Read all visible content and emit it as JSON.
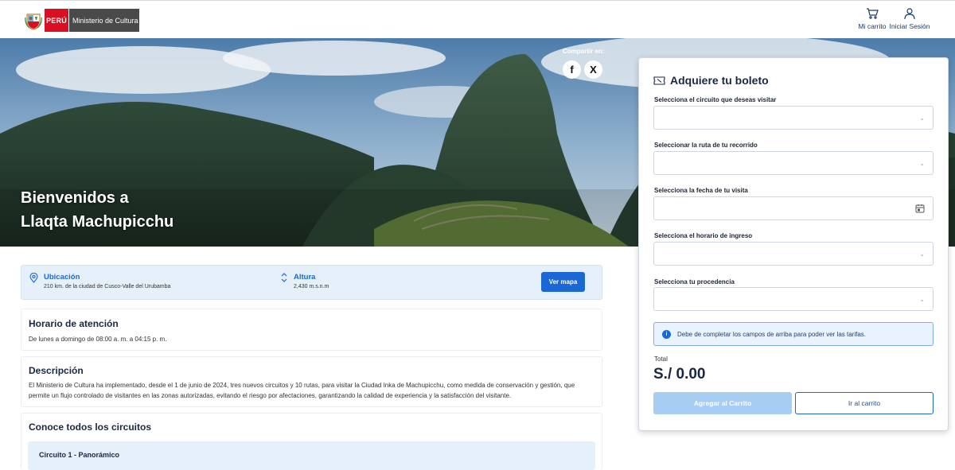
{
  "header": {
    "country_badge": "PERÚ",
    "ministry_badge": "Ministerio de Cultura",
    "cart_label": "Mi carrito",
    "login_label": "Iniciar Sesión"
  },
  "hero": {
    "title_line1": "Bienvenidos a",
    "title_line2": "Llaqta Machupicchu",
    "share_label": "Compartir en:",
    "share_facebook_glyph": "f",
    "share_x_glyph": "X"
  },
  "ticket": {
    "title": "Adquiere tu boleto",
    "fields": [
      {
        "label": "Selecciona el circuito que deseas visitar",
        "value": ""
      },
      {
        "label": "Seleccionar la ruta de tu recorrido",
        "value": ""
      },
      {
        "label": "Selecciona la fecha de tu visita",
        "value": ""
      },
      {
        "label": "Selecciona el horario de ingreso",
        "value": ""
      },
      {
        "label": "Selecciona tu procedencia",
        "value": ""
      }
    ],
    "info_message": "Debe de completar los campos de arriba para poder ver las tarifas.",
    "info_glyph": "i",
    "total_label": "Total",
    "total_value": "S./ 0.00",
    "add_button": "Agregar al Carrito",
    "go_cart_button": "Ir al carrito"
  },
  "location": {
    "ubicacion_title": "Ubicación",
    "ubicacion_text": "210 km. de la ciudad de Cusco-Valle del Urubamba",
    "altura_title": "Altura",
    "altura_text": "2,430 m.s.n.m",
    "map_button": "Ver mapa"
  },
  "horario": {
    "title": "Horario de atención",
    "text": "De lunes a domingo de 08:00 a. m. a 04:15 p. m."
  },
  "descripcion": {
    "title": "Descripción",
    "text": "El Ministerio de Cultura ha implementado, desde el 1 de junio de 2024, tres nuevos circuitos y 10 rutas, para visitar la Ciudad Inka de Machupicchu, como medida de conservación y gestión, que permite un flujo controlado de visitantes en las zonas autorizadas, evitando el riesgo por afectaciones, garantizando la calidad de experiencia y la satisfacción del visitante."
  },
  "circuitos": {
    "title": "Conoce todos los circuitos",
    "items": [
      "Circuito 1 - Panorámico"
    ]
  }
}
